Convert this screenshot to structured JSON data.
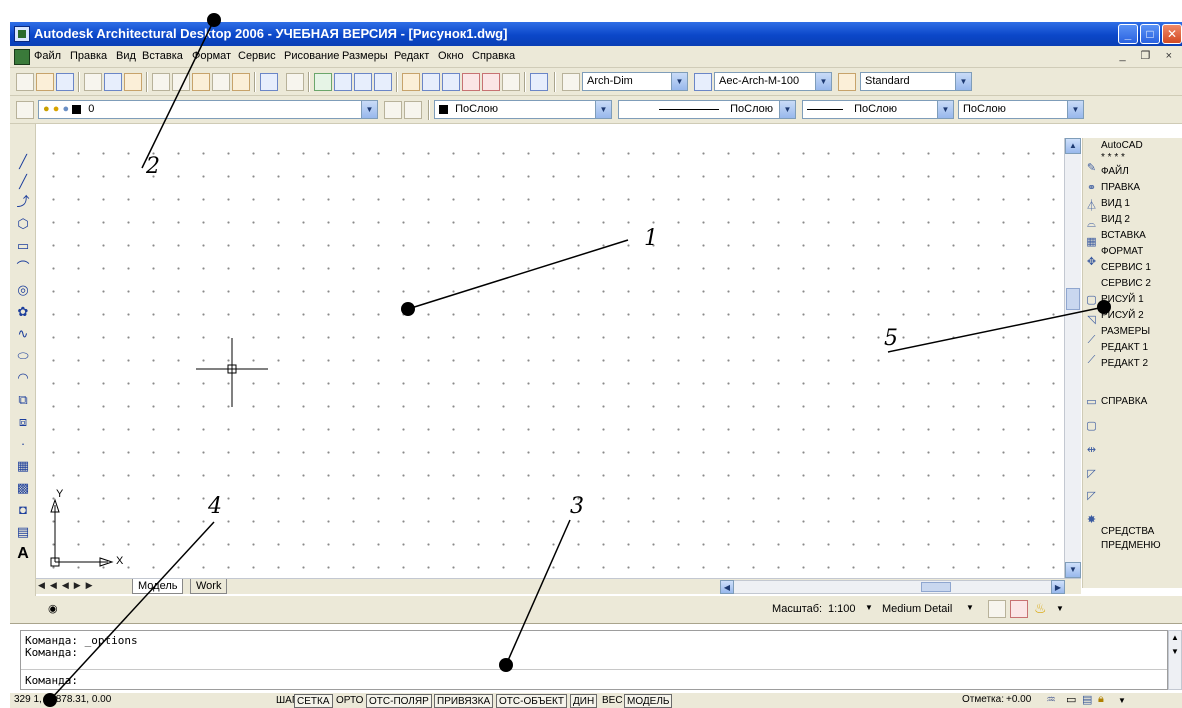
{
  "window": {
    "title": "Autodesk Architectural Desktop 2006 - УЧЕБНАЯ ВЕРСИЯ - [Рисунок1.dwg]",
    "minimize_glyph": "_",
    "maximize_glyph": "□",
    "close_glyph": "✕",
    "mdi_controls": "_ ❐ ×"
  },
  "menu": {
    "items": [
      "Файл",
      "Правка",
      "Вид",
      "Вставка",
      "Формат",
      "Сервис",
      "Рисование",
      "Размеры",
      "Редакт",
      "Окно",
      "Справка"
    ]
  },
  "toolbar_standard": {
    "dim_style": "Arch-Dim",
    "text_style": "Aec-Arch-M-100",
    "table_style": "Standard"
  },
  "toolbar_layers": {
    "layer": "0",
    "color": "ПоСлою",
    "linetype": "ПоСлою",
    "lineweight": "ПоСлою",
    "plotstyle": "ПоСлою"
  },
  "right_panel": {
    "items": [
      "AutoCAD",
      "* * * *",
      "ФАЙЛ",
      "ПРАВКА",
      "ВИД 1",
      "ВИД 2",
      "ВСТАВКА",
      "ФОРМАТ",
      "СЕРВИС 1",
      "СЕРВИС 2",
      "РИСУЙ 1",
      "РИСУЙ 2",
      "РАЗМЕРЫ",
      "РЕДАКТ 1",
      "РЕДАКТ 2",
      "СПРАВКА",
      "СРЕДСТВА",
      "ПРЕДМЕНЮ"
    ]
  },
  "ucs": {
    "x_label": "X",
    "y_label": "Y"
  },
  "tabs": [
    "Модель",
    "Work"
  ],
  "scale_row": {
    "scale_label": "Масштаб:",
    "scale_value": "1:100",
    "detail": "Medium Detail"
  },
  "command_line": {
    "lines": [
      "Команда: _options",
      "Команда:",
      "Команда:"
    ]
  },
  "status_bar": {
    "coords": "329 1, 19878.31, 0.00",
    "buttons": [
      "ШАГ",
      "СЕТКА",
      "ОРТО",
      "ОТС-ПОЛЯР",
      "ПРИВЯЗКА",
      "ОТС-ОБЪЕКТ",
      "ДИН",
      "ВЕС",
      "МОДЕЛЬ"
    ],
    "buttons_on": [
      false,
      true,
      false,
      true,
      true,
      true,
      true,
      false,
      true
    ],
    "elevation_label": "Отметка:",
    "elevation_value": "+0.00"
  },
  "callouts": [
    "1",
    "2",
    "3",
    "4",
    "5"
  ]
}
